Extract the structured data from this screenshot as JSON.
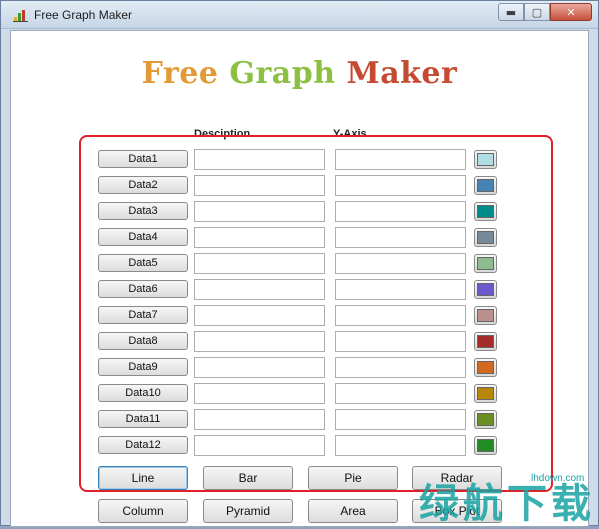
{
  "window": {
    "title": "Free Graph Maker",
    "minimize_icon": "minimize-icon",
    "maximize_icon": "maximize-icon",
    "close_icon": "close-icon",
    "minimize_glyph": "▬",
    "maximize_glyph": "▢",
    "close_glyph": "✕"
  },
  "app": {
    "title_part1": "Free ",
    "title_part2": "Graph ",
    "title_part3": "Maker",
    "color_part1": "#e19a35",
    "color_part2": "#8cc043",
    "color_part3": "#c44a32"
  },
  "headers": {
    "description": "Desciption",
    "y_axis": "Y-Axis"
  },
  "rows": [
    {
      "label": "Data1",
      "description": "",
      "y_value": "",
      "color": "#b0dde4"
    },
    {
      "label": "Data2",
      "description": "",
      "y_value": "",
      "color": "#4682b4"
    },
    {
      "label": "Data3",
      "description": "",
      "y_value": "",
      "color": "#008b8b"
    },
    {
      "label": "Data4",
      "description": "",
      "y_value": "",
      "color": "#778899"
    },
    {
      "label": "Data5",
      "description": "",
      "y_value": "",
      "color": "#8fbc8f"
    },
    {
      "label": "Data6",
      "description": "",
      "y_value": "",
      "color": "#6a5acd"
    },
    {
      "label": "Data7",
      "description": "",
      "y_value": "",
      "color": "#bc8f8f"
    },
    {
      "label": "Data8",
      "description": "",
      "y_value": "",
      "color": "#a52a2a"
    },
    {
      "label": "Data9",
      "description": "",
      "y_value": "",
      "color": "#d2691e"
    },
    {
      "label": "Data10",
      "description": "",
      "y_value": "",
      "color": "#b8860b"
    },
    {
      "label": "Data11",
      "description": "",
      "y_value": "",
      "color": "#6b8e23"
    },
    {
      "label": "Data12",
      "description": "",
      "y_value": "",
      "color": "#228b22"
    }
  ],
  "chart_buttons": {
    "line": "Line",
    "bar": "Bar",
    "pie": "Pie",
    "radar": "Radar",
    "column": "Column",
    "pyramid": "Pyramid",
    "area": "Area",
    "box_plot": "Box Plot"
  },
  "watermark": {
    "chinese": "绿航下载",
    "url": "lhdown.com"
  }
}
